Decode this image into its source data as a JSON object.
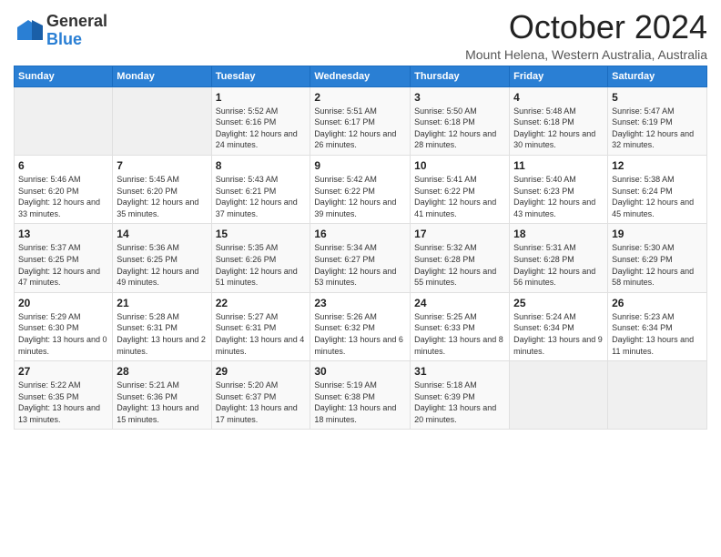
{
  "logo": {
    "general": "General",
    "blue": "Blue"
  },
  "title": "October 2024",
  "location": "Mount Helena, Western Australia, Australia",
  "days_of_week": [
    "Sunday",
    "Monday",
    "Tuesday",
    "Wednesday",
    "Thursday",
    "Friday",
    "Saturday"
  ],
  "weeks": [
    [
      {
        "day": "",
        "sunrise": "",
        "sunset": "",
        "daylight": ""
      },
      {
        "day": "",
        "sunrise": "",
        "sunset": "",
        "daylight": ""
      },
      {
        "day": "1",
        "sunrise": "Sunrise: 5:52 AM",
        "sunset": "Sunset: 6:16 PM",
        "daylight": "Daylight: 12 hours and 24 minutes."
      },
      {
        "day": "2",
        "sunrise": "Sunrise: 5:51 AM",
        "sunset": "Sunset: 6:17 PM",
        "daylight": "Daylight: 12 hours and 26 minutes."
      },
      {
        "day": "3",
        "sunrise": "Sunrise: 5:50 AM",
        "sunset": "Sunset: 6:18 PM",
        "daylight": "Daylight: 12 hours and 28 minutes."
      },
      {
        "day": "4",
        "sunrise": "Sunrise: 5:48 AM",
        "sunset": "Sunset: 6:18 PM",
        "daylight": "Daylight: 12 hours and 30 minutes."
      },
      {
        "day": "5",
        "sunrise": "Sunrise: 5:47 AM",
        "sunset": "Sunset: 6:19 PM",
        "daylight": "Daylight: 12 hours and 32 minutes."
      }
    ],
    [
      {
        "day": "6",
        "sunrise": "Sunrise: 5:46 AM",
        "sunset": "Sunset: 6:20 PM",
        "daylight": "Daylight: 12 hours and 33 minutes."
      },
      {
        "day": "7",
        "sunrise": "Sunrise: 5:45 AM",
        "sunset": "Sunset: 6:20 PM",
        "daylight": "Daylight: 12 hours and 35 minutes."
      },
      {
        "day": "8",
        "sunrise": "Sunrise: 5:43 AM",
        "sunset": "Sunset: 6:21 PM",
        "daylight": "Daylight: 12 hours and 37 minutes."
      },
      {
        "day": "9",
        "sunrise": "Sunrise: 5:42 AM",
        "sunset": "Sunset: 6:22 PM",
        "daylight": "Daylight: 12 hours and 39 minutes."
      },
      {
        "day": "10",
        "sunrise": "Sunrise: 5:41 AM",
        "sunset": "Sunset: 6:22 PM",
        "daylight": "Daylight: 12 hours and 41 minutes."
      },
      {
        "day": "11",
        "sunrise": "Sunrise: 5:40 AM",
        "sunset": "Sunset: 6:23 PM",
        "daylight": "Daylight: 12 hours and 43 minutes."
      },
      {
        "day": "12",
        "sunrise": "Sunrise: 5:38 AM",
        "sunset": "Sunset: 6:24 PM",
        "daylight": "Daylight: 12 hours and 45 minutes."
      }
    ],
    [
      {
        "day": "13",
        "sunrise": "Sunrise: 5:37 AM",
        "sunset": "Sunset: 6:25 PM",
        "daylight": "Daylight: 12 hours and 47 minutes."
      },
      {
        "day": "14",
        "sunrise": "Sunrise: 5:36 AM",
        "sunset": "Sunset: 6:25 PM",
        "daylight": "Daylight: 12 hours and 49 minutes."
      },
      {
        "day": "15",
        "sunrise": "Sunrise: 5:35 AM",
        "sunset": "Sunset: 6:26 PM",
        "daylight": "Daylight: 12 hours and 51 minutes."
      },
      {
        "day": "16",
        "sunrise": "Sunrise: 5:34 AM",
        "sunset": "Sunset: 6:27 PM",
        "daylight": "Daylight: 12 hours and 53 minutes."
      },
      {
        "day": "17",
        "sunrise": "Sunrise: 5:32 AM",
        "sunset": "Sunset: 6:28 PM",
        "daylight": "Daylight: 12 hours and 55 minutes."
      },
      {
        "day": "18",
        "sunrise": "Sunrise: 5:31 AM",
        "sunset": "Sunset: 6:28 PM",
        "daylight": "Daylight: 12 hours and 56 minutes."
      },
      {
        "day": "19",
        "sunrise": "Sunrise: 5:30 AM",
        "sunset": "Sunset: 6:29 PM",
        "daylight": "Daylight: 12 hours and 58 minutes."
      }
    ],
    [
      {
        "day": "20",
        "sunrise": "Sunrise: 5:29 AM",
        "sunset": "Sunset: 6:30 PM",
        "daylight": "Daylight: 13 hours and 0 minutes."
      },
      {
        "day": "21",
        "sunrise": "Sunrise: 5:28 AM",
        "sunset": "Sunset: 6:31 PM",
        "daylight": "Daylight: 13 hours and 2 minutes."
      },
      {
        "day": "22",
        "sunrise": "Sunrise: 5:27 AM",
        "sunset": "Sunset: 6:31 PM",
        "daylight": "Daylight: 13 hours and 4 minutes."
      },
      {
        "day": "23",
        "sunrise": "Sunrise: 5:26 AM",
        "sunset": "Sunset: 6:32 PM",
        "daylight": "Daylight: 13 hours and 6 minutes."
      },
      {
        "day": "24",
        "sunrise": "Sunrise: 5:25 AM",
        "sunset": "Sunset: 6:33 PM",
        "daylight": "Daylight: 13 hours and 8 minutes."
      },
      {
        "day": "25",
        "sunrise": "Sunrise: 5:24 AM",
        "sunset": "Sunset: 6:34 PM",
        "daylight": "Daylight: 13 hours and 9 minutes."
      },
      {
        "day": "26",
        "sunrise": "Sunrise: 5:23 AM",
        "sunset": "Sunset: 6:34 PM",
        "daylight": "Daylight: 13 hours and 11 minutes."
      }
    ],
    [
      {
        "day": "27",
        "sunrise": "Sunrise: 5:22 AM",
        "sunset": "Sunset: 6:35 PM",
        "daylight": "Daylight: 13 hours and 13 minutes."
      },
      {
        "day": "28",
        "sunrise": "Sunrise: 5:21 AM",
        "sunset": "Sunset: 6:36 PM",
        "daylight": "Daylight: 13 hours and 15 minutes."
      },
      {
        "day": "29",
        "sunrise": "Sunrise: 5:20 AM",
        "sunset": "Sunset: 6:37 PM",
        "daylight": "Daylight: 13 hours and 17 minutes."
      },
      {
        "day": "30",
        "sunrise": "Sunrise: 5:19 AM",
        "sunset": "Sunset: 6:38 PM",
        "daylight": "Daylight: 13 hours and 18 minutes."
      },
      {
        "day": "31",
        "sunrise": "Sunrise: 5:18 AM",
        "sunset": "Sunset: 6:39 PM",
        "daylight": "Daylight: 13 hours and 20 minutes."
      },
      {
        "day": "",
        "sunrise": "",
        "sunset": "",
        "daylight": ""
      },
      {
        "day": "",
        "sunrise": "",
        "sunset": "",
        "daylight": ""
      }
    ]
  ]
}
